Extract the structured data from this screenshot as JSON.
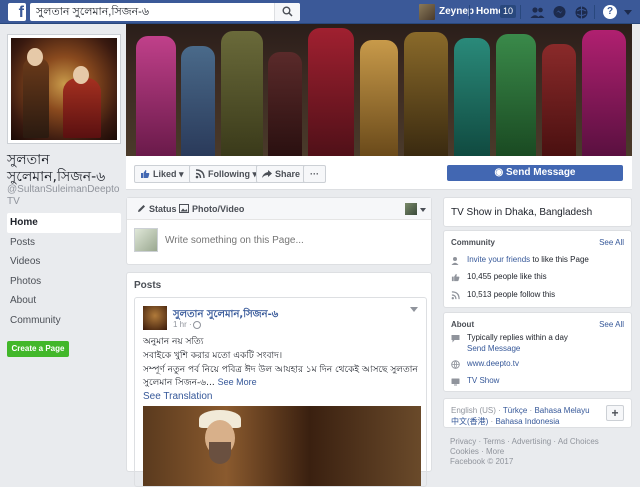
{
  "topbar": {
    "logo": "f",
    "search_value": "সুলতান সুলেমান,সিজন-৬",
    "user": "Zeynep",
    "home": "Home",
    "home_badge": "10",
    "help": "?"
  },
  "left": {
    "page_name": "সুলতান সুলেমান,সিজন-৬",
    "handle": "@SultanSuleimanDeeptoTV",
    "nav": [
      "Home",
      "Posts",
      "Videos",
      "Photos",
      "About",
      "Community"
    ],
    "create_page": "Create a Page"
  },
  "actions": {
    "liked": "Liked",
    "following": "Following",
    "share": "Share",
    "more": "···",
    "send_message": "Send Message"
  },
  "composer": {
    "status": "Status",
    "photo_video": "Photo/Video",
    "placeholder": "Write something on this Page..."
  },
  "posts": {
    "header": "Posts",
    "author": "সুলতান সুলেমান,সিজন-৬",
    "time": "1 hr ·",
    "line1": "অনুমান নয় সত্যি",
    "line2": "সবাইকে খুশি করার মতো একটি সংবাদ।",
    "line3": "সম্পূর্ণ নতুন পর্ব নিয়ে পবিত্র ঈদ উল আযহার ১ম দিন থেকেই আসছে সুলতান সুলেমান সিজন-৬...",
    "see_more": "See More",
    "see_translation": "See Translation"
  },
  "right": {
    "category": "TV Show in Dhaka, Bangladesh",
    "community_title": "Community",
    "see_all": "See All",
    "invite_link": "Invite your friends",
    "invite_rest": " to like this Page",
    "likes": "10,455 people like this",
    "follows": "10,513 people follow this",
    "about_title": "About",
    "replies": "Typically replies within a day",
    "send_message_link": "Send Message",
    "website": "www.deepto.tv",
    "type": "TV Show",
    "languages_line1_a": "English (US)",
    "languages_line1_b": "Türkçe",
    "languages_line1_c": "Bahasa Melayu",
    "languages_line2_a": "中文(香港)",
    "languages_line2_b": "Bahasa Indonesia",
    "plus": "+",
    "footer_line1": "Privacy · Terms · Advertising · Ad Choices",
    "footer_line2": "Cookies · More",
    "footer_line3": "Facebook © 2017"
  },
  "colors": {
    "brand": "#3b5998",
    "accent_button": "#4267b2",
    "create_page": "#42b72a"
  }
}
